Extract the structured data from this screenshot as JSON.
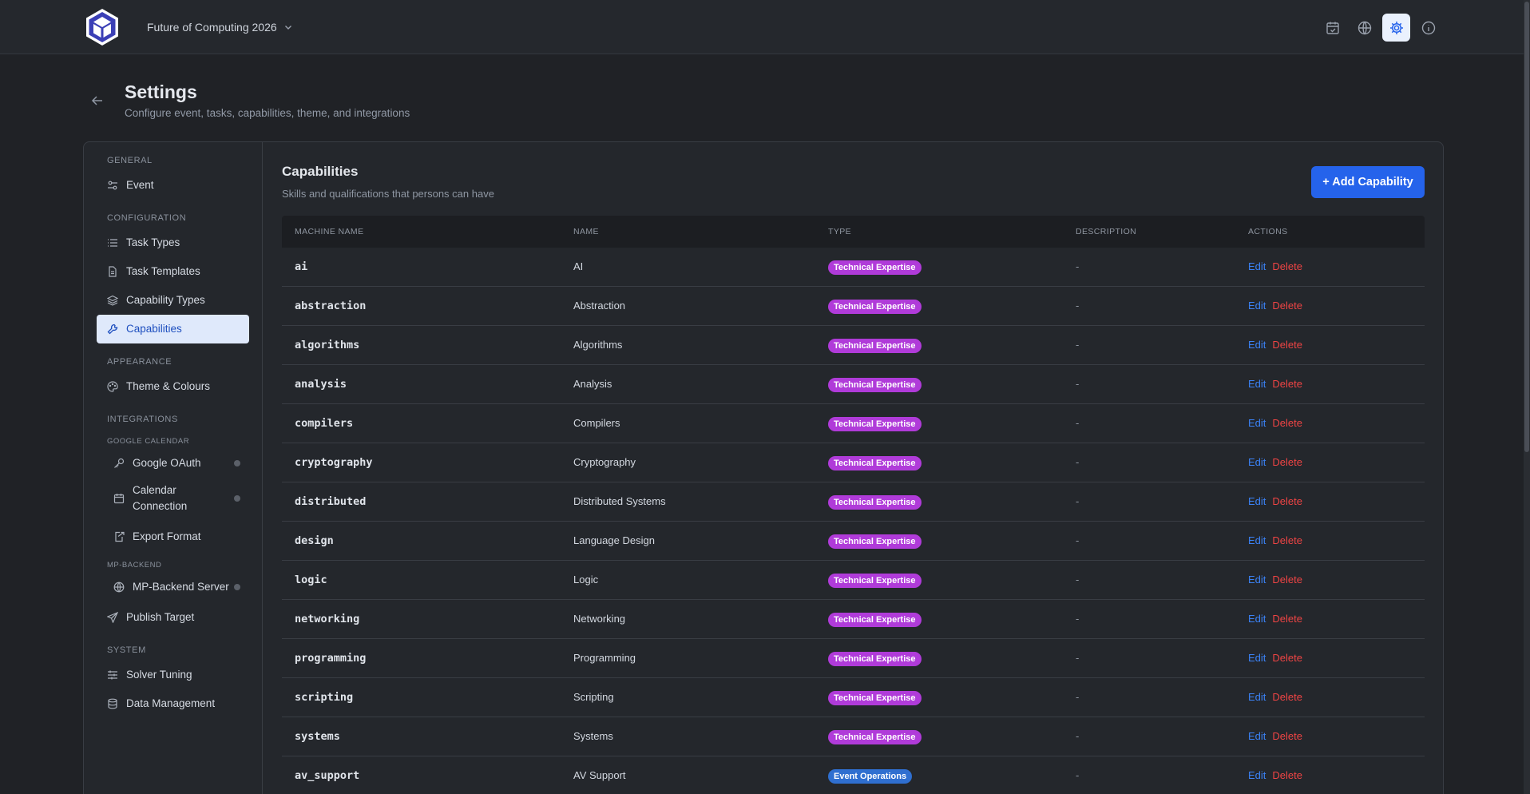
{
  "topbar": {
    "event_name": "Future of Computing 2026",
    "icons": [
      "calendar-check-icon",
      "globe-icon",
      "gear-icon",
      "info-icon"
    ]
  },
  "header": {
    "title": "Settings",
    "subtitle": "Configure event, tasks, capabilities, theme, and integrations"
  },
  "sidebar": {
    "general": "GENERAL",
    "event": "Event",
    "configuration": "CONFIGURATION",
    "task_types": "Task Types",
    "task_templates": "Task Templates",
    "capability_types": "Capability Types",
    "capabilities": "Capabilities",
    "appearance": "APPEARANCE",
    "theme": "Theme & Colours",
    "integrations": "INTEGRATIONS",
    "google_calendar": "GOOGLE CALENDAR",
    "google_oauth": "Google OAuth",
    "calendar_connection": "Calendar Connection",
    "export_format": "Export Format",
    "mp_backend": "MP-BACKEND",
    "mp_backend_server": "MP-Backend Server",
    "publish_target": "Publish Target",
    "system": "SYSTEM",
    "solver_tuning": "Solver Tuning",
    "data_management": "Data Management"
  },
  "capabilities": {
    "title": "Capabilities",
    "description": "Skills and qualifications that persons can have",
    "add_label": "+ Add Capability",
    "columns": [
      "MACHINE NAME",
      "NAME",
      "TYPE",
      "DESCRIPTION",
      "ACTIONS"
    ],
    "edit_label": "Edit",
    "delete_label": "Delete",
    "rows": [
      {
        "machine": "ai",
        "name": "AI",
        "type": "Technical Expertise",
        "desc": "-"
      },
      {
        "machine": "abstraction",
        "name": "Abstraction",
        "type": "Technical Expertise",
        "desc": "-"
      },
      {
        "machine": "algorithms",
        "name": "Algorithms",
        "type": "Technical Expertise",
        "desc": "-"
      },
      {
        "machine": "analysis",
        "name": "Analysis",
        "type": "Technical Expertise",
        "desc": "-"
      },
      {
        "machine": "compilers",
        "name": "Compilers",
        "type": "Technical Expertise",
        "desc": "-"
      },
      {
        "machine": "cryptography",
        "name": "Cryptography",
        "type": "Technical Expertise",
        "desc": "-"
      },
      {
        "machine": "distributed",
        "name": "Distributed Systems",
        "type": "Technical Expertise",
        "desc": "-"
      },
      {
        "machine": "design",
        "name": "Language Design",
        "type": "Technical Expertise",
        "desc": "-"
      },
      {
        "machine": "logic",
        "name": "Logic",
        "type": "Technical Expertise",
        "desc": "-"
      },
      {
        "machine": "networking",
        "name": "Networking",
        "type": "Technical Expertise",
        "desc": "-"
      },
      {
        "machine": "programming",
        "name": "Programming",
        "type": "Technical Expertise",
        "desc": "-"
      },
      {
        "machine": "scripting",
        "name": "Scripting",
        "type": "Technical Expertise",
        "desc": "-"
      },
      {
        "machine": "systems",
        "name": "Systems",
        "type": "Technical Expertise",
        "desc": "-"
      },
      {
        "machine": "av_support",
        "name": "AV Support",
        "type": "Event Operations",
        "desc": "-"
      }
    ]
  }
}
